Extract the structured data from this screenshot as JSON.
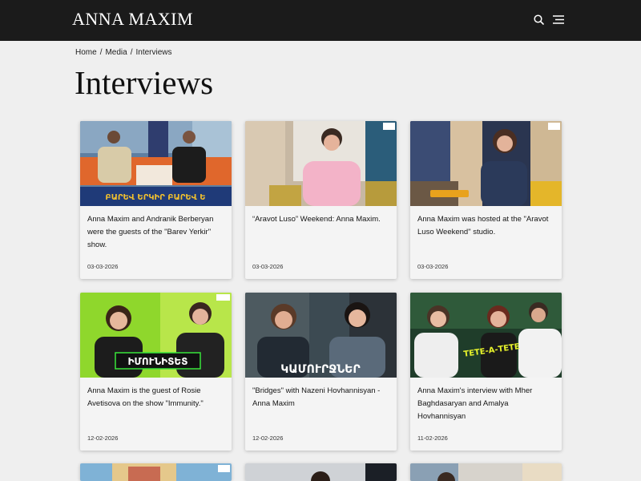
{
  "header": {
    "logo": "ANNA MAXIM",
    "search_icon": "search-icon",
    "menu_icon": "hamburger-menu-icon"
  },
  "breadcrumb": {
    "home": "Home",
    "media": "Media",
    "current": "Interviews",
    "separator": "/"
  },
  "page": {
    "title": "Interviews"
  },
  "cards": [
    {
      "title": "Anna Maxim and Andranik Berberyan were the guests of the \"Barev Yerkir\" show.",
      "date": "03-03-2026",
      "overlay_text": "ԲԱՐԵՎ ԵՐԿԻՐ   ԲԱՐԵՎ Ե"
    },
    {
      "title": "“Aravot Luso” Weekend: Anna Maxim.",
      "date": "03-03-2026"
    },
    {
      "title": "Anna Maxim was hosted at the \"Aravot Luso Weekend\" studio.",
      "date": "03-03-2026"
    },
    {
      "title": "Anna Maxim is the guest of Rosie Avetisova on the show \"Immunity.\"",
      "date": "12-02-2026",
      "overlay_text": "ԻՄՈՒՆԻՏԵՏ"
    },
    {
      "title": "\"Bridges\" with Nazeni Hovhannisyan - Anna Maxim",
      "date": "12-02-2026",
      "overlay_text": "ԿԱՄՈՒՐՋՆԵՐ"
    },
    {
      "title": "Anna Maxim's interview with Mher Baghdasaryan and Amalya Hovhannisyan",
      "date": "11-02-2026",
      "overlay_text": "ТЕТЕ-А-ТЕТЕ"
    }
  ],
  "colors": {
    "header_bg": "#1b1b1b",
    "page_bg": "#efefef",
    "card_bg": "#f4f4f4"
  }
}
